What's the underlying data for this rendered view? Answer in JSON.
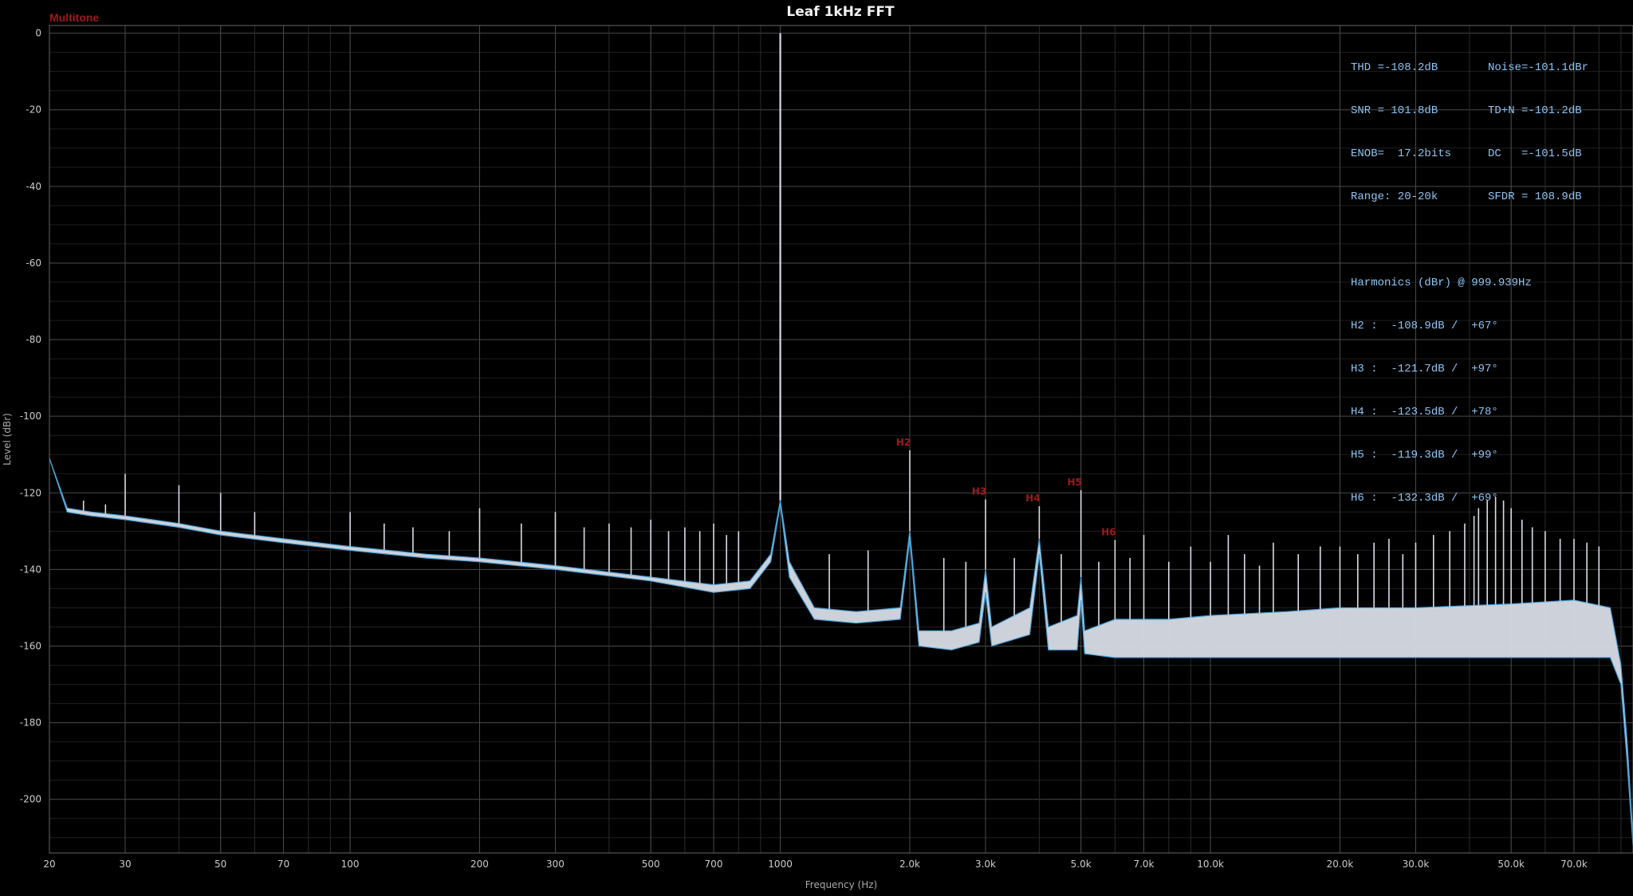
{
  "brand": "Multitone",
  "colors": {
    "background": "#000000",
    "grid": "#3a3a3a",
    "trace": "#d8dce6",
    "trace_edge": "#4aa3d8",
    "marker": "#a01818",
    "stats": "#8fc4f2"
  },
  "stats": {
    "rows": [
      [
        "THD =-108.2dB",
        "Noise=-101.1dBr"
      ],
      [
        "SNR = 101.8dB",
        "TD+N =-101.2dB"
      ],
      [
        "ENOB=  17.2bits",
        "DC   =-101.5dB"
      ],
      [
        "Range: 20-20k",
        "SFDR = 108.9dB"
      ]
    ],
    "harmonics_title": "Harmonics (dBr) @ 999.939Hz",
    "harmonics": [
      "H2 :  -108.9dB /  +67°",
      "H3 :  -121.7dB /  +97°",
      "H4 :  -123.5dB /  +78°",
      "H5 :  -119.3dB /  +99°",
      "H6 :  -132.3dB /  +69°"
    ]
  },
  "chart_data": {
    "type": "line",
    "title": "Leaf 1kHz FFT",
    "xlabel": "Frequency (Hz)",
    "ylabel": "Level (dBr)",
    "x_scale": "log",
    "xlim": [
      20,
      96000
    ],
    "ylim": [
      -214,
      2
    ],
    "grid": true,
    "x_ticks": [
      {
        "v": 20,
        "label": "20"
      },
      {
        "v": 30,
        "label": "30"
      },
      {
        "v": 50,
        "label": "50"
      },
      {
        "v": 70,
        "label": "70"
      },
      {
        "v": 100,
        "label": "100"
      },
      {
        "v": 200,
        "label": "200"
      },
      {
        "v": 300,
        "label": "300"
      },
      {
        "v": 500,
        "label": "500"
      },
      {
        "v": 700,
        "label": "700"
      },
      {
        "v": 1000,
        "label": "1000"
      },
      {
        "v": 2000,
        "label": "2.0k"
      },
      {
        "v": 3000,
        "label": "3.0k"
      },
      {
        "v": 5000,
        "label": "5.0k"
      },
      {
        "v": 7000,
        "label": "7.0k"
      },
      {
        "v": 10000,
        "label": "10.0k"
      },
      {
        "v": 20000,
        "label": "20.0k"
      },
      {
        "v": 30000,
        "label": "30.0k"
      },
      {
        "v": 50000,
        "label": "50.0k"
      },
      {
        "v": 70000,
        "label": "70.0k"
      }
    ],
    "y_ticks": [
      0,
      -20,
      -40,
      -60,
      -80,
      -100,
      -120,
      -140,
      -160,
      -180,
      -200
    ],
    "harmonic_markers": [
      {
        "label": "H2",
        "x": 2000,
        "y": -108.9
      },
      {
        "label": "H3",
        "x": 3000,
        "y": -121.7
      },
      {
        "label": "H4",
        "x": 4000,
        "y": -123.5
      },
      {
        "label": "H5",
        "x": 5000,
        "y": -119.3
      },
      {
        "label": "H6",
        "x": 6000,
        "y": -132.3
      }
    ],
    "series": [
      {
        "floor_upper": [
          [
            20,
            -111
          ],
          [
            22,
            -124
          ],
          [
            25,
            -125
          ],
          [
            30,
            -126
          ],
          [
            40,
            -128
          ],
          [
            50,
            -130
          ],
          [
            70,
            -132
          ],
          [
            100,
            -134
          ],
          [
            150,
            -136
          ],
          [
            200,
            -137
          ],
          [
            300,
            -139
          ],
          [
            500,
            -142
          ],
          [
            700,
            -144
          ],
          [
            850,
            -143
          ],
          [
            950,
            -136
          ],
          [
            1000,
            -122
          ],
          [
            1050,
            -138
          ],
          [
            1200,
            -150
          ],
          [
            1500,
            -151
          ],
          [
            1900,
            -150
          ],
          [
            2000,
            -130
          ],
          [
            2100,
            -156
          ],
          [
            2500,
            -156
          ],
          [
            2900,
            -154
          ],
          [
            3000,
            -140
          ],
          [
            3100,
            -155
          ],
          [
            3800,
            -150
          ],
          [
            4000,
            -132
          ],
          [
            4200,
            -155
          ],
          [
            4900,
            -152
          ],
          [
            5000,
            -142
          ],
          [
            5100,
            -156
          ],
          [
            6000,
            -153
          ],
          [
            8000,
            -153
          ],
          [
            10000,
            -152
          ],
          [
            15000,
            -151
          ],
          [
            20000,
            -150
          ],
          [
            30000,
            -150
          ],
          [
            50000,
            -149
          ],
          [
            70000,
            -148
          ],
          [
            85000,
            -150
          ],
          [
            90000,
            -165
          ],
          [
            93000,
            -185
          ],
          [
            96000,
            -210
          ]
        ],
        "floor_lower": [
          [
            20,
            -111
          ],
          [
            22,
            -125
          ],
          [
            25,
            -126
          ],
          [
            30,
            -127
          ],
          [
            40,
            -129
          ],
          [
            50,
            -131
          ],
          [
            70,
            -133
          ],
          [
            100,
            -135
          ],
          [
            150,
            -137
          ],
          [
            200,
            -138
          ],
          [
            300,
            -140
          ],
          [
            500,
            -143
          ],
          [
            700,
            -146
          ],
          [
            850,
            -145
          ],
          [
            950,
            -138
          ],
          [
            1000,
            -123
          ],
          [
            1050,
            -142
          ],
          [
            1200,
            -153
          ],
          [
            1500,
            -154
          ],
          [
            1900,
            -153
          ],
          [
            2000,
            -132
          ],
          [
            2100,
            -160
          ],
          [
            2500,
            -161
          ],
          [
            2900,
            -159
          ],
          [
            3000,
            -146
          ],
          [
            3100,
            -160
          ],
          [
            3800,
            -157
          ],
          [
            4000,
            -136
          ],
          [
            4200,
            -161
          ],
          [
            4900,
            -161
          ],
          [
            5000,
            -148
          ],
          [
            5100,
            -162
          ],
          [
            6000,
            -163
          ],
          [
            8000,
            -163
          ],
          [
            10000,
            -163
          ],
          [
            15000,
            -163
          ],
          [
            20000,
            -163
          ],
          [
            30000,
            -163
          ],
          [
            50000,
            -163
          ],
          [
            70000,
            -163
          ],
          [
            85000,
            -163
          ],
          [
            90000,
            -170
          ],
          [
            93000,
            -190
          ],
          [
            96000,
            -212
          ]
        ],
        "peaks": [
          [
            24,
            -122
          ],
          [
            27,
            -123
          ],
          [
            30,
            -115
          ],
          [
            40,
            -118
          ],
          [
            50,
            -120
          ],
          [
            60,
            -125
          ],
          [
            100,
            -125
          ],
          [
            120,
            -128
          ],
          [
            140,
            -129
          ],
          [
            170,
            -130
          ],
          [
            200,
            -124
          ],
          [
            250,
            -128
          ],
          [
            300,
            -125
          ],
          [
            350,
            -129
          ],
          [
            400,
            -128
          ],
          [
            450,
            -129
          ],
          [
            500,
            -127
          ],
          [
            550,
            -130
          ],
          [
            600,
            -129
          ],
          [
            650,
            -130
          ],
          [
            700,
            -128
          ],
          [
            750,
            -131
          ],
          [
            800,
            -130
          ],
          [
            1000,
            0
          ],
          [
            2000,
            -108.9
          ],
          [
            3000,
            -121.7
          ],
          [
            4000,
            -123.5
          ],
          [
            5000,
            -119.3
          ],
          [
            6000,
            -132.3
          ],
          [
            1300,
            -136
          ],
          [
            1600,
            -135
          ],
          [
            2400,
            -137
          ],
          [
            2700,
            -138
          ],
          [
            3500,
            -137
          ],
          [
            4500,
            -136
          ],
          [
            5500,
            -138
          ],
          [
            6500,
            -137
          ],
          [
            7000,
            -131
          ],
          [
            8000,
            -138
          ],
          [
            9000,
            -134
          ],
          [
            10000,
            -138
          ],
          [
            11000,
            -131
          ],
          [
            12000,
            -136
          ],
          [
            13000,
            -139
          ],
          [
            14000,
            -133
          ],
          [
            16000,
            -136
          ],
          [
            18000,
            -134
          ],
          [
            20000,
            -134
          ],
          [
            22000,
            -136
          ],
          [
            24000,
            -133
          ],
          [
            26000,
            -132
          ],
          [
            28000,
            -136
          ],
          [
            30000,
            -133
          ],
          [
            33000,
            -131
          ],
          [
            36000,
            -130
          ],
          [
            39000,
            -128
          ],
          [
            41000,
            -126
          ],
          [
            42000,
            -124
          ],
          [
            44000,
            -122
          ],
          [
            46000,
            -121
          ],
          [
            48000,
            -122
          ],
          [
            50000,
            -124
          ],
          [
            53000,
            -127
          ],
          [
            56000,
            -129
          ],
          [
            60000,
            -130
          ],
          [
            65000,
            -132
          ],
          [
            70000,
            -132
          ],
          [
            75000,
            -133
          ],
          [
            80000,
            -134
          ]
        ]
      }
    ]
  }
}
